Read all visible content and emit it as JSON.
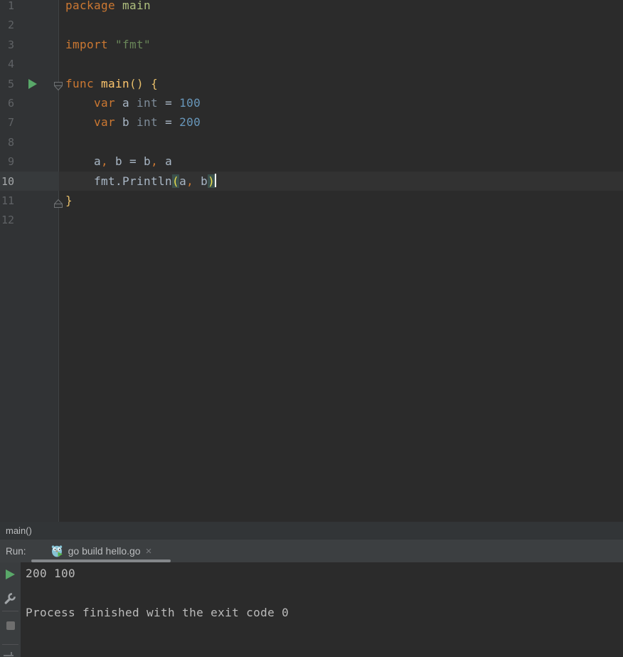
{
  "editor": {
    "lines": [
      {
        "n": "1",
        "segs": [
          [
            "kw",
            "package"
          ],
          [
            "def",
            " "
          ],
          [
            "pkg",
            "main"
          ]
        ]
      },
      {
        "n": "2",
        "segs": []
      },
      {
        "n": "3",
        "segs": [
          [
            "kw",
            "import"
          ],
          [
            "def",
            " "
          ],
          [
            "str",
            "\"fmt\""
          ]
        ]
      },
      {
        "n": "4",
        "segs": []
      },
      {
        "n": "5",
        "segs": [
          [
            "kw",
            "func"
          ],
          [
            "def",
            " "
          ],
          [
            "fn",
            "main"
          ],
          [
            "brace",
            "()"
          ],
          [
            "def",
            " "
          ],
          [
            "brace",
            "{"
          ]
        ],
        "run_icon": true,
        "fold": "down"
      },
      {
        "n": "6",
        "segs": [
          [
            "def",
            "    "
          ],
          [
            "kw",
            "var"
          ],
          [
            "def",
            " a "
          ],
          [
            "type",
            "int"
          ],
          [
            "def",
            " = "
          ],
          [
            "num",
            "100"
          ]
        ]
      },
      {
        "n": "7",
        "segs": [
          [
            "def",
            "    "
          ],
          [
            "kw",
            "var"
          ],
          [
            "def",
            " b "
          ],
          [
            "type",
            "int"
          ],
          [
            "def",
            " = "
          ],
          [
            "num",
            "200"
          ]
        ]
      },
      {
        "n": "8",
        "segs": []
      },
      {
        "n": "9",
        "segs": [
          [
            "def",
            "    a"
          ],
          [
            "comma",
            ","
          ],
          [
            "def",
            " b = b"
          ],
          [
            "comma",
            ","
          ],
          [
            "def",
            " a"
          ]
        ]
      },
      {
        "n": "10",
        "segs": [
          [
            "def",
            "    fmt.Println"
          ],
          [
            "match",
            "("
          ],
          [
            "def",
            "a"
          ],
          [
            "comma",
            ","
          ],
          [
            "def",
            " b"
          ],
          [
            "match",
            ")"
          ]
        ],
        "active": true,
        "cursor": true
      },
      {
        "n": "11",
        "segs": [
          [
            "brace",
            "}"
          ]
        ],
        "fold": "up"
      },
      {
        "n": "12",
        "segs": []
      }
    ]
  },
  "breadcrumb": {
    "label": "main()"
  },
  "run_panel": {
    "title": "Run:",
    "tab": {
      "icon": "gopher-icon",
      "label": "go build hello.go",
      "close": "×"
    }
  },
  "console": {
    "lines": [
      "200 100",
      "",
      "Process finished with the exit code 0"
    ]
  },
  "icons": {
    "gutter_run": "run-icon",
    "fold_down": "fold-down-icon",
    "fold_up": "fold-up-icon",
    "rerun": "rerun-icon",
    "settings": "wrench-icon",
    "stop": "stop-icon",
    "tab_icon": "gopher-icon",
    "tab_close": "close-icon"
  },
  "colors": {
    "editor_bg": "#2b2b2b",
    "gutter_bg": "#313335",
    "caret_row": "#323232",
    "keyword": "#cc7832",
    "string": "#6a8759",
    "number": "#6897bb",
    "function": "#ffc66d",
    "package_name": "#afbf7e",
    "type": "#7e8c99",
    "default_text": "#a9b7c6",
    "brace_match_bg": "#3b514d",
    "brace_match_fg": "#ede04a",
    "run_green": "#59a869",
    "console_text": "#bbbbbb",
    "tool_header_bg": "#3c3f41",
    "tab_underline": "#84878a"
  }
}
